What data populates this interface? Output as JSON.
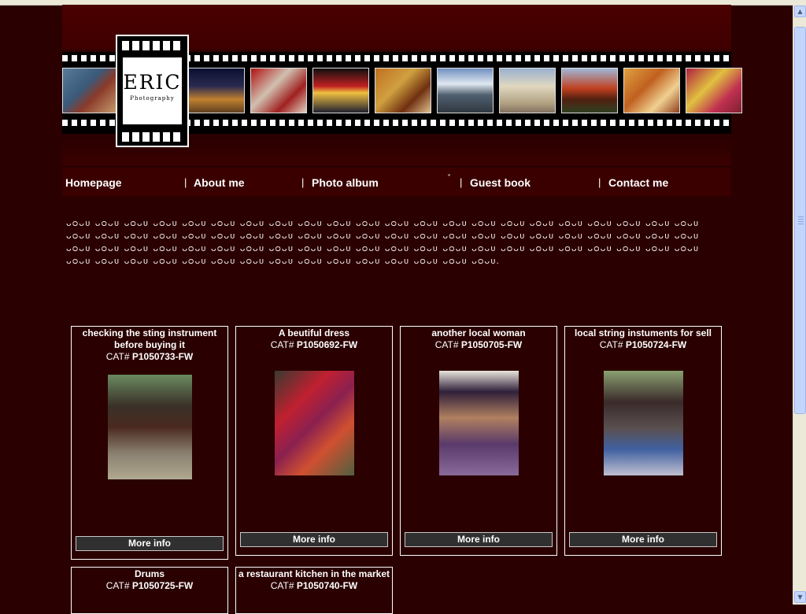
{
  "logo": {
    "name": "Eric",
    "tagline": "Photography"
  },
  "nav": {
    "items": [
      "Homepage",
      "About me",
      "Photo album",
      "Guest book",
      "Contact me"
    ],
    "separator": "|",
    "dropdown_icon": "chevron-down-icon"
  },
  "intro_text": "ᴗᴑᴗᴜ ᴗᴑᴗᴜ ᴗᴑᴗᴜ ᴗᴑᴗᴜ ᴗᴑᴗᴜ ᴗᴑᴗᴜ ᴗᴑᴗᴜ ᴗᴑᴗᴜ ᴗᴑᴗᴜ ᴗᴑᴗᴜ ᴗᴑᴗᴜ ᴗᴑᴗᴜ ᴗᴑᴗᴜ ᴗᴑᴗᴜ ᴗᴑᴗᴜ ᴗᴑᴗᴜ ᴗᴑᴗᴜ ᴗᴑᴗᴜ ᴗᴑᴗᴜ ᴗᴑᴗᴜ ᴗᴑᴗᴜ ᴗᴑᴗᴜ ᴗᴑᴗᴜ ᴗᴑᴗᴜ ᴗᴑᴗᴜ ᴗᴑᴗᴜ ᴗᴑᴗᴜ ᴗᴑᴗᴜ ᴗᴑᴗᴜ ᴗᴑᴗᴜ ᴗᴑᴗᴜ ᴗᴑᴗᴜ ᴗᴑᴗᴜ ᴗᴑᴗᴜ ᴗᴑᴗᴜ ᴗᴑᴗᴜ ᴗᴑᴗᴜ ᴗᴑᴗᴜ ᴗᴑᴗᴜ ᴗᴑᴗᴜ ᴗᴑᴗᴜ ᴗᴑᴗᴜ ᴗᴑᴗᴜ ᴗᴑᴗᴜ ᴗᴑᴗᴜ ᴗᴑᴗᴜ ᴗᴑᴗᴜ ᴗᴑᴗᴜ ᴗᴑᴗᴜ ᴗᴑᴗᴜ ᴗᴑᴗᴜ ᴗᴑᴗᴜ ᴗᴑᴗᴜ ᴗᴑᴗᴜ ᴗᴑᴗᴜ ᴗᴑᴗᴜ ᴗᴑᴗᴜ ᴗᴑᴗᴜ ᴗᴑᴗᴜ ᴗᴑᴗᴜ ᴗᴑᴗᴜ ᴗᴑᴗᴜ ᴗᴑᴗᴜ ᴗᴑᴗᴜ ᴗᴑᴗᴜ ᴗᴑᴗᴜ ᴗᴑᴗᴜ ᴗᴑᴗᴜ ᴗᴑᴗᴜ ᴗᴑᴗᴜ ᴗᴑᴗᴜ ᴗᴑᴗᴜ ᴗᴑᴗᴜ ᴗᴑᴗᴜ ᴗᴑᴗᴜ ᴗᴑᴗᴜ ᴗᴑᴗᴜ ᴗᴑᴗᴜ ᴗᴑᴗᴜ ᴗᴑᴗᴜ ᴗᴑᴗᴜ.",
  "cat_prefix": "CAT#",
  "products": [
    {
      "title": "checking the sting instrument before buying it",
      "cat": "P1050733-FW",
      "button": "More info"
    },
    {
      "title": "A beutiful dress",
      "cat": "P1050692-FW",
      "button": "More info"
    },
    {
      "title": "another local woman",
      "cat": "P1050705-FW",
      "button": "More info"
    },
    {
      "title": "local string instuments for sell",
      "cat": "P1050724-FW",
      "button": "More info"
    },
    {
      "title": "Drums",
      "cat": "P1050725-FW"
    },
    {
      "title": "a restaurant kitchen in the market",
      "cat": "P1050740-FW"
    }
  ],
  "colors": {
    "page_background": "#2a0000",
    "header_top": "#4a0000",
    "nav_background": "#3a0000",
    "button_background": "#303030",
    "card_border": "#ffffff"
  },
  "scrollbar": {
    "up_icon": "arrow-up-icon",
    "down_icon": "arrow-down-icon"
  }
}
